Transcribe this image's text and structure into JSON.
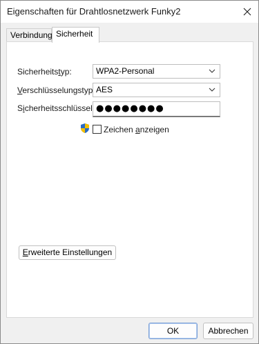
{
  "window": {
    "title": "Eigenschaften für Drahtlosnetzwerk Funky2",
    "close_icon": "close-icon"
  },
  "tabs": [
    {
      "label": "Verbindung",
      "active": false
    },
    {
      "label": "Sicherheit",
      "active": true
    }
  ],
  "security": {
    "type_label_pre": "Sicherheits",
    "type_label_u": "t",
    "type_label_post": "yp:",
    "type_value": "WPA2-Personal",
    "encryption_label_pre": "",
    "encryption_label_u": "V",
    "encryption_label_post": "erschlüsselungstyp:",
    "encryption_value": "AES",
    "key_label_pre": "S",
    "key_label_u": "i",
    "key_label_post": "cherheitsschlüssel",
    "key_value": "●●●●●●●●",
    "show_chars_pre": "Zeichen ",
    "show_chars_u": "a",
    "show_chars_post": "nzeigen",
    "show_chars_checked": false,
    "shield_icon": "uac-shield-icon"
  },
  "advanced_button": {
    "pre": "",
    "u": "E",
    "post": "rweiterte Einstellungen"
  },
  "footer": {
    "ok_label": "OK",
    "cancel_label": "Abbrechen"
  }
}
